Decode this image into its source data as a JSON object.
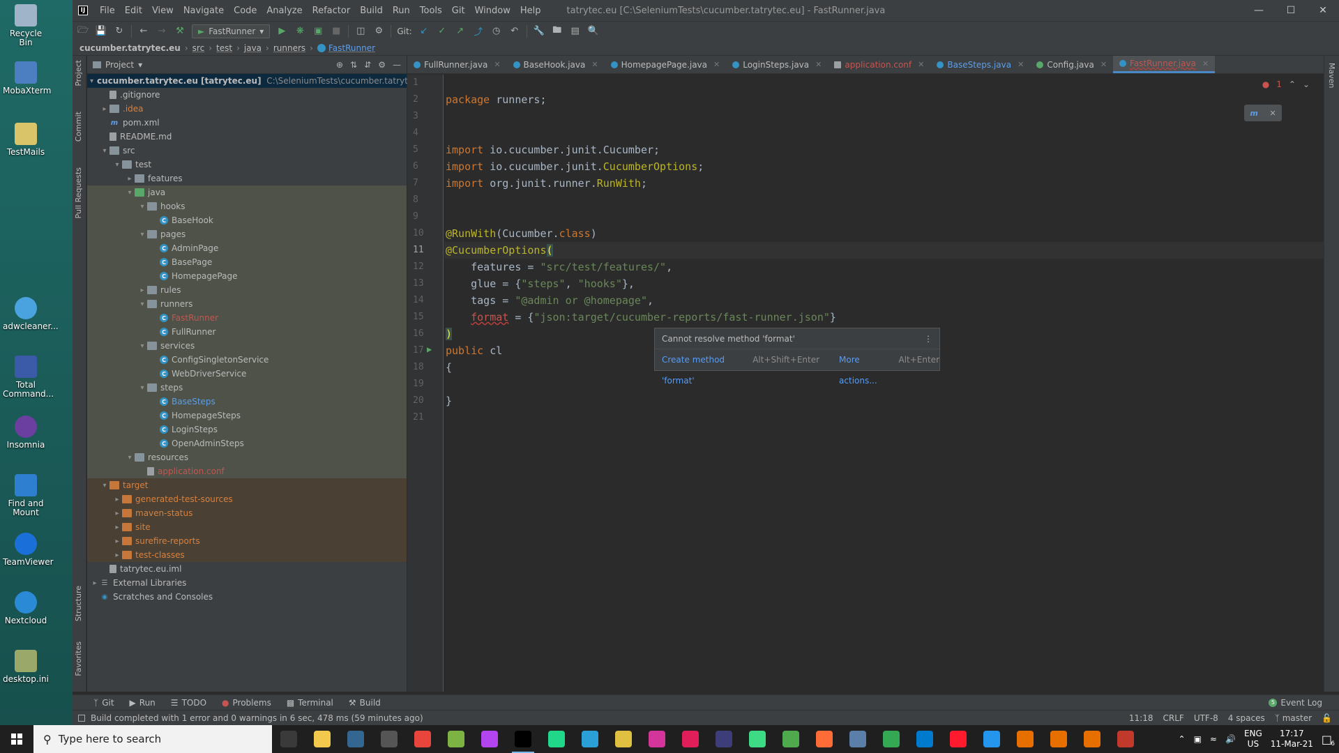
{
  "desktop": {
    "icons": [
      {
        "label": "Recycle Bin",
        "color": "#9fb4c8"
      },
      {
        "label": "MobaXterm",
        "color": "#4b7fc2"
      },
      {
        "label": "TestMails",
        "color": "#d9c46a"
      },
      {
        "label": "adwcleaner...",
        "color": "#4aa3df"
      },
      {
        "label": "Total Command...",
        "color": "#3b5aa8"
      },
      {
        "label": "Insomnia",
        "color": "#6b3fa0"
      },
      {
        "label": "Find and Mount",
        "color": "#2f7fd0"
      },
      {
        "label": "TeamViewer",
        "color": "#1b6fd8"
      },
      {
        "label": "Nextcloud",
        "color": "#2a8ad6"
      },
      {
        "label": "desktop.ini",
        "color": "#9aa86a"
      }
    ]
  },
  "titlebar": {
    "menu": [
      "File",
      "Edit",
      "View",
      "Navigate",
      "Code",
      "Analyze",
      "Refactor",
      "Build",
      "Run",
      "Tools",
      "Git",
      "Window",
      "Help"
    ],
    "title": "tatrytec.eu [C:\\SeleniumTests\\cucumber.tatrytec.eu] - FastRunner.java"
  },
  "toolbar": {
    "run_config": "FastRunner",
    "git_label": "Git:"
  },
  "navbar": {
    "crumbs": [
      "cucumber.tatrytec.eu",
      "src",
      "test",
      "java",
      "runners",
      "FastRunner"
    ]
  },
  "side_tabs": {
    "project": "Project",
    "commit": "Commit",
    "pull_requests": "Pull Requests",
    "structure": "Structure",
    "favorites": "Favorites",
    "maven": "Maven"
  },
  "project_panel": {
    "title": "Project",
    "tree": [
      {
        "text": "cucumber.tatrytec.eu [tatrytec.eu]",
        "extra": "C:\\SeleniumTests\\cucumber.tatrytec.eu"
      },
      {
        "text": ".gitignore"
      },
      {
        "text": ".idea"
      },
      {
        "text": "pom.xml"
      },
      {
        "text": "README.md"
      },
      {
        "text": "src"
      },
      {
        "text": "test"
      },
      {
        "text": "features"
      },
      {
        "text": "java"
      },
      {
        "text": "hooks"
      },
      {
        "text": "BaseHook"
      },
      {
        "text": "pages"
      },
      {
        "text": "AdminPage"
      },
      {
        "text": "BasePage"
      },
      {
        "text": "HomepagePage"
      },
      {
        "text": "rules"
      },
      {
        "text": "runners"
      },
      {
        "text": "FastRunner"
      },
      {
        "text": "FullRunner"
      },
      {
        "text": "services"
      },
      {
        "text": "ConfigSingletonService"
      },
      {
        "text": "WebDriverService"
      },
      {
        "text": "steps"
      },
      {
        "text": "BaseSteps"
      },
      {
        "text": "HomepageSteps"
      },
      {
        "text": "LoginSteps"
      },
      {
        "text": "OpenAdminSteps"
      },
      {
        "text": "resources"
      },
      {
        "text": "application.conf"
      },
      {
        "text": "target"
      },
      {
        "text": "generated-test-sources"
      },
      {
        "text": "maven-status"
      },
      {
        "text": "site"
      },
      {
        "text": "surefire-reports"
      },
      {
        "text": "test-classes"
      },
      {
        "text": "tatrytec.eu.iml"
      },
      {
        "text": "External Libraries"
      },
      {
        "text": "Scratches and Consoles"
      }
    ]
  },
  "editor": {
    "tabs": [
      "FullRunner.java",
      "BaseHook.java",
      "HomepagePage.java",
      "LoginSteps.java",
      "application.conf",
      "BaseSteps.java",
      "Config.java",
      "FastRunner.java"
    ],
    "line_numbers": [
      "1",
      "2",
      "3",
      "4",
      "5",
      "6",
      "7",
      "8",
      "9",
      "10",
      "11",
      "12",
      "13",
      "14",
      "15",
      "16",
      "17",
      "18",
      "19",
      "20",
      "21"
    ],
    "code": {
      "l2_kw": "package",
      "l2_rest": " runners;",
      "l5_kw": "import",
      "l5_rest": " io.cucumber.junit.Cucumber;",
      "l6_kw": "import",
      "l6_rest": " io.cucumber.junit.",
      "l6_cls": "CucumberOptions",
      "l6_end": ";",
      "l7_kw": "import",
      "l7_rest": " org.junit.runner.",
      "l7_cls": "RunWith",
      "l7_end": ";",
      "l10_ann": "@RunWith",
      "l10_rest": "(Cucumber.",
      "l10_kw": "class",
      "l10_end": ")",
      "l11_ann": "@CucumberOptions",
      "l11_paren": "(",
      "l12_a": "    features = ",
      "l12_str": "\"src/test/features/\"",
      "l12_b": ",",
      "l13_a": "    glue = {",
      "l13_s1": "\"steps\"",
      "l13_b": ", ",
      "l13_s2": "\"hooks\"",
      "l13_c": "},",
      "l14_a": "    tags = ",
      "l14_str": "\"@admin or @homepage\"",
      "l14_b": ",",
      "l15_a": "    ",
      "l15_err": "format",
      "l15_b": " = {",
      "l15_str": "\"json:target/cucumber-reports/fast-runner.json\"",
      "l15_c": "}",
      "l16": ")",
      "l17_kw": "public",
      "l17_rest": " cl",
      "l18": "{",
      "l20": "}"
    },
    "error_count": "1"
  },
  "error_popup": {
    "message": "Cannot resolve method 'format'",
    "action1": "Create method 'format'",
    "action1_key": "Alt+Shift+Enter",
    "action2": "More actions...",
    "action2_key": "Alt+Enter"
  },
  "bottom_tools": {
    "git": "Git",
    "run": "Run",
    "todo": "TODO",
    "problems": "Problems",
    "terminal": "Terminal",
    "build": "Build",
    "event_log": "Event Log",
    "event_count": "5"
  },
  "statusbar": {
    "message": "Build completed with 1 error and 0 warnings in 6 sec, 478 ms (59 minutes ago)",
    "position": "11:18",
    "line_sep": "CRLF",
    "encoding": "UTF-8",
    "indent": "4 spaces",
    "branch": "master"
  },
  "taskbar": {
    "search_placeholder": "Type here to search",
    "lang_top": "ENG",
    "lang_bottom": "US",
    "time": "17:17",
    "date": "11-Mar-21",
    "notification_count": "6",
    "apps": [
      {
        "name": "task-view",
        "color": "#3a3a3a"
      },
      {
        "name": "file-explorer",
        "color": "#f2c94c"
      },
      {
        "name": "postgres",
        "color": "#336791"
      },
      {
        "name": "app-cursor",
        "color": "#555555"
      },
      {
        "name": "chrome",
        "color": "#e8453c"
      },
      {
        "name": "notepad",
        "color": "#7cb342"
      },
      {
        "name": "phpstorm",
        "color": "#b345f1"
      },
      {
        "name": "intellij",
        "color": "#000000"
      },
      {
        "name": "pycharm",
        "color": "#21d789"
      },
      {
        "name": "editor",
        "color": "#2b9fd8"
      },
      {
        "name": "git-tool",
        "color": "#e0c040"
      },
      {
        "name": "app-magenta",
        "color": "#d3359a"
      },
      {
        "name": "slack",
        "color": "#e01e5a"
      },
      {
        "name": "keepass",
        "color": "#3d3d7a"
      },
      {
        "name": "android-studio",
        "color": "#3ddc84"
      },
      {
        "name": "mongodb",
        "color": "#4fa94d"
      },
      {
        "name": "postman",
        "color": "#ff6c37"
      },
      {
        "name": "network-tool",
        "color": "#5a7fa8"
      },
      {
        "name": "maps",
        "color": "#34a853"
      },
      {
        "name": "vscode",
        "color": "#007acc"
      },
      {
        "name": "opera",
        "color": "#ff1b2d"
      },
      {
        "name": "docker",
        "color": "#2496ed"
      },
      {
        "name": "java-app-1",
        "color": "#e76f00"
      },
      {
        "name": "java-app-2",
        "color": "#e76f00"
      },
      {
        "name": "java-app-3",
        "color": "#e76f00"
      },
      {
        "name": "screen-tool",
        "color": "#c0392b"
      }
    ]
  }
}
